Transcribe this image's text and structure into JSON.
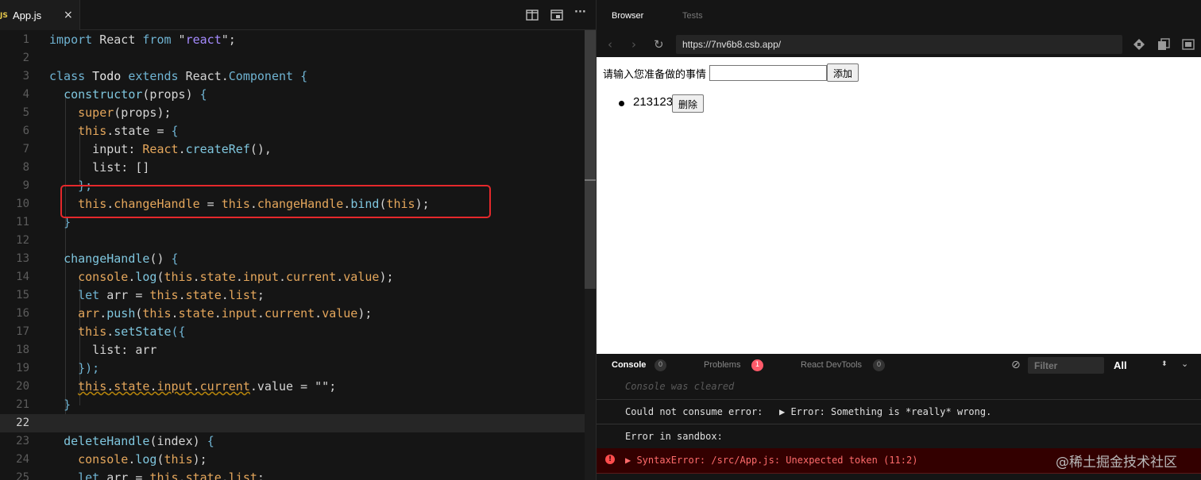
{
  "editor": {
    "tab": {
      "badge": "JS",
      "filename": "App.js",
      "close": "×"
    },
    "toolbar": {
      "more": "···"
    },
    "lines": [
      {
        "n": "1",
        "code": [
          [
            "import",
            "kw"
          ],
          [
            " React ",
            "id"
          ],
          [
            "from",
            "kw"
          ],
          [
            " \"",
            "id"
          ],
          [
            "react",
            "str"
          ],
          [
            "\";",
            "id"
          ]
        ]
      },
      {
        "n": "2",
        "code": []
      },
      {
        "n": "3",
        "code": [
          [
            "class",
            "kw"
          ],
          [
            " Todo ",
            "ty"
          ],
          [
            "extends",
            "kw"
          ],
          [
            " React.",
            "id"
          ],
          [
            "Component",
            "ty2"
          ],
          [
            " {",
            "br"
          ]
        ]
      },
      {
        "n": "4",
        "code": [
          [
            "  ",
            "id"
          ],
          [
            "constructor",
            "fn"
          ],
          [
            "(props) ",
            "id"
          ],
          [
            "{",
            "br"
          ]
        ]
      },
      {
        "n": "5",
        "code": [
          [
            "    ",
            "id"
          ],
          [
            "super",
            "th"
          ],
          [
            "(props);",
            "id"
          ]
        ]
      },
      {
        "n": "6",
        "code": [
          [
            "    ",
            "id"
          ],
          [
            "this",
            "th"
          ],
          [
            ".state = ",
            "id"
          ],
          [
            "{",
            "br"
          ]
        ]
      },
      {
        "n": "7",
        "code": [
          [
            "      input: ",
            "id"
          ],
          [
            "React",
            "th"
          ],
          [
            ".",
            "id"
          ],
          [
            "createRef",
            "fn"
          ],
          [
            "(),",
            "id"
          ]
        ]
      },
      {
        "n": "8",
        "code": [
          [
            "      list: []",
            "id"
          ]
        ]
      },
      {
        "n": "9",
        "code": [
          [
            "    ",
            "id"
          ],
          [
            "};",
            "br"
          ]
        ]
      },
      {
        "n": "10",
        "code": [
          [
            "    ",
            "id"
          ],
          [
            "this",
            "th"
          ],
          [
            ".",
            "id"
          ],
          [
            "changeHandle",
            "th"
          ],
          [
            " = ",
            "id"
          ],
          [
            "this",
            "th"
          ],
          [
            ".",
            "id"
          ],
          [
            "changeHandle",
            "th"
          ],
          [
            ".",
            "id"
          ],
          [
            "bind",
            "fn"
          ],
          [
            "(",
            "id"
          ],
          [
            "this",
            "th"
          ],
          [
            ");",
            "id"
          ]
        ]
      },
      {
        "n": "11",
        "code": [
          [
            "  ",
            "id"
          ],
          [
            "}",
            "br"
          ]
        ]
      },
      {
        "n": "12",
        "code": []
      },
      {
        "n": "13",
        "code": [
          [
            "  ",
            "id"
          ],
          [
            "changeHandle",
            "fn"
          ],
          [
            "() ",
            "id"
          ],
          [
            "{",
            "br"
          ]
        ]
      },
      {
        "n": "14",
        "code": [
          [
            "    ",
            "id"
          ],
          [
            "console",
            "th"
          ],
          [
            ".",
            "id"
          ],
          [
            "log",
            "fn"
          ],
          [
            "(",
            "id"
          ],
          [
            "this",
            "th"
          ],
          [
            ".",
            "id"
          ],
          [
            "state",
            "th"
          ],
          [
            ".",
            "id"
          ],
          [
            "input",
            "th"
          ],
          [
            ".",
            "id"
          ],
          [
            "current",
            "th"
          ],
          [
            ".",
            "id"
          ],
          [
            "value",
            "th"
          ],
          [
            ");",
            "id"
          ]
        ]
      },
      {
        "n": "15",
        "code": [
          [
            "    ",
            "id"
          ],
          [
            "let",
            "kw"
          ],
          [
            " arr = ",
            "id"
          ],
          [
            "this",
            "th"
          ],
          [
            ".",
            "id"
          ],
          [
            "state",
            "th"
          ],
          [
            ".",
            "id"
          ],
          [
            "list",
            "th"
          ],
          [
            ";",
            "id"
          ]
        ]
      },
      {
        "n": "16",
        "code": [
          [
            "    ",
            "id"
          ],
          [
            "arr",
            "th"
          ],
          [
            ".",
            "id"
          ],
          [
            "push",
            "fn"
          ],
          [
            "(",
            "id"
          ],
          [
            "this",
            "th"
          ],
          [
            ".",
            "id"
          ],
          [
            "state",
            "th"
          ],
          [
            ".",
            "id"
          ],
          [
            "input",
            "th"
          ],
          [
            ".",
            "id"
          ],
          [
            "current",
            "th"
          ],
          [
            ".",
            "id"
          ],
          [
            "value",
            "th"
          ],
          [
            ");",
            "id"
          ]
        ]
      },
      {
        "n": "17",
        "code": [
          [
            "    ",
            "id"
          ],
          [
            "this",
            "th"
          ],
          [
            ".",
            "id"
          ],
          [
            "setState",
            "fn"
          ],
          [
            "({",
            "br"
          ]
        ]
      },
      {
        "n": "18",
        "code": [
          [
            "      list: arr",
            "id"
          ]
        ]
      },
      {
        "n": "19",
        "code": [
          [
            "    ",
            "id"
          ],
          [
            "});",
            "br"
          ]
        ]
      },
      {
        "n": "20",
        "code": [
          [
            "    ",
            "id"
          ],
          [
            "this",
            "sqth"
          ],
          [
            ".",
            "sq"
          ],
          [
            "state",
            "sqth"
          ],
          [
            ".",
            "sq"
          ],
          [
            "input",
            "sqth"
          ],
          [
            ".",
            "sq"
          ],
          [
            "current",
            "sqth"
          ],
          [
            ".value = \"\";",
            "id"
          ]
        ]
      },
      {
        "n": "21",
        "code": [
          [
            "  ",
            "id"
          ],
          [
            "}",
            "br"
          ]
        ]
      },
      {
        "n": "22",
        "code": [],
        "current": true
      },
      {
        "n": "23",
        "code": [
          [
            "  ",
            "id"
          ],
          [
            "deleteHandle",
            "fn"
          ],
          [
            "(index) ",
            "id"
          ],
          [
            "{",
            "br"
          ]
        ]
      },
      {
        "n": "24",
        "code": [
          [
            "    ",
            "id"
          ],
          [
            "console",
            "th"
          ],
          [
            ".",
            "id"
          ],
          [
            "log",
            "fn"
          ],
          [
            "(",
            "id"
          ],
          [
            "this",
            "th"
          ],
          [
            ");",
            "id"
          ]
        ]
      },
      {
        "n": "25",
        "code": [
          [
            "    ",
            "id"
          ],
          [
            "let",
            "kw"
          ],
          [
            " arr = ",
            "id"
          ],
          [
            "this",
            "th"
          ],
          [
            ".",
            "id"
          ],
          [
            "state",
            "th"
          ],
          [
            ".",
            "id"
          ],
          [
            "list",
            "th"
          ],
          [
            ";",
            "id"
          ]
        ]
      }
    ]
  },
  "browser": {
    "tabs": [
      "Browser",
      "Tests"
    ],
    "url": "https://7nv6b8.csb.app/",
    "preview": {
      "label": "请输入您准备做的事情",
      "add_button": "添加",
      "items": [
        {
          "text": "213123",
          "delete_button": "删除"
        }
      ]
    }
  },
  "console": {
    "tabs": [
      {
        "label": "Console",
        "count": "0"
      },
      {
        "label": "Problems",
        "count": "1"
      },
      {
        "label": "React DevTools",
        "count": "0"
      }
    ],
    "filter_placeholder": "Filter",
    "level": "All",
    "cleared": "Console was cleared",
    "error_prefix": "Could not consume error:",
    "error_detail": "▶ Error: Something is *really* wrong.",
    "sandbox_error": "Error in sandbox:",
    "syntax_error": "▶ SyntaxError: /src/App.js: Unexpected token (11:2)"
  },
  "watermark": "@稀土掘金技术社区",
  "colors": {
    "kw": "#6fb3d2",
    "ty": "#e4e4e4",
    "ty2": "#6fb3d2",
    "fn": "#7fc6de",
    "th": "#e5a75c",
    "str": "#a58bff",
    "br": "#6fb3d2",
    "id": "#d4d4d4",
    "error_bg": "#330000",
    "error_text": "#ff6b6b",
    "highlight_box": "#e5282b"
  }
}
